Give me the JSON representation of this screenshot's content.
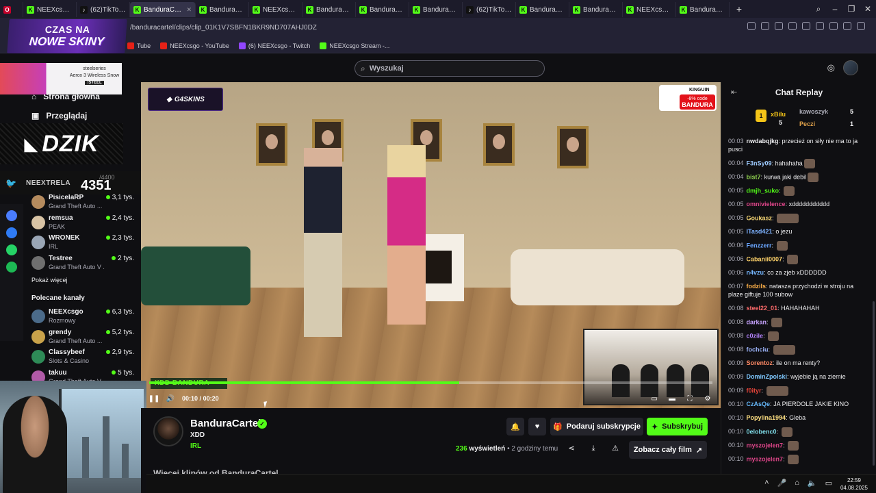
{
  "browser": {
    "tabs": [
      {
        "icon": "kick",
        "label": "NEEXcsgo Stream"
      },
      {
        "icon": "tiktok",
        "label": "(62)TikTok - Make"
      },
      {
        "icon": "kick",
        "label": "BanduraCartel - Watch",
        "active": true
      },
      {
        "icon": "kick",
        "label": "BanduraCartel - V"
      },
      {
        "icon": "kick",
        "label": "NEEXcsgo Stream"
      },
      {
        "icon": "kick",
        "label": "BanduraCartel - V"
      },
      {
        "icon": "kick",
        "label": "BanduraCartel - V"
      },
      {
        "icon": "kick",
        "label": "BanduraCartel - V"
      },
      {
        "icon": "tiktok",
        "label": "(62)TikTok - Make"
      },
      {
        "icon": "kick",
        "label": "BanduraCartel - V"
      },
      {
        "icon": "kick",
        "label": "BanduraCartel - V"
      },
      {
        "icon": "kick",
        "label": "NEEXcsgo Stream"
      },
      {
        "icon": "kick",
        "label": "BanduraCartel - V"
      }
    ],
    "new_tab_label": "+",
    "url": "/banduracartel/clips/clip_01K1V7SBFN1BKR9ND707AHJ0DZ",
    "bookmarks": [
      {
        "label": "Tube",
        "icon": "youtube"
      },
      {
        "label": "NEEXcsgo - YouTube",
        "icon": "youtube"
      },
      {
        "label": "(6) NEEXcsgo - Twitch",
        "icon": "twitch"
      },
      {
        "label": "NEEXcsgo Stream -...",
        "icon": "kick"
      }
    ]
  },
  "overlays": {
    "czas_line1": "CZAS NA",
    "czas_line2": "NOWE SKINY",
    "steelseries_brand": "steelseries",
    "steelseries_product": "Aerox 3 Wireless Snow",
    "steelseries_code": "!STEEL",
    "dzik_logo": "DZIK",
    "neex_handle": "NEEXTRELA",
    "goal": "/4400",
    "counter": "4351",
    "video_watermark": "G4SKINS",
    "kinguin_brand": "KINGUIN",
    "kinguin_discount": "-8% code",
    "kinguin_code": "BANDURA",
    "caption": "XDD BANDURA"
  },
  "sidebar": {
    "nav": [
      {
        "label": "Strona główna",
        "icon": "home-icon"
      },
      {
        "label": "Przeglądaj",
        "icon": "browse-icon"
      }
    ],
    "followed": [
      {
        "name": "PisicelaRP",
        "category": "Grand Theft Auto ...",
        "viewers": "3,1 tys.",
        "color": "#b58b5e"
      },
      {
        "name": "remsua",
        "category": "PEAK",
        "viewers": "2,4 tys.",
        "color": "#d8c3a5"
      },
      {
        "name": "WRONEK",
        "category": "IRL",
        "viewers": "2,3 tys.",
        "color": "#9aa6b6"
      },
      {
        "name": "Testree",
        "category": "Grand Theft Auto V ...",
        "viewers": "2 tys.",
        "color": "#6f6f6f"
      }
    ],
    "show_more": "Pokaż więcej",
    "recommended_heading": "Polecane kanały",
    "recommended": [
      {
        "name": "NEEXcsgo",
        "category": "Rozmowy",
        "viewers": "6,3 tys.",
        "color": "#4b6b8a"
      },
      {
        "name": "grendy",
        "category": "Grand Theft Auto ...",
        "viewers": "5,2 tys.",
        "color": "#c9a24a"
      },
      {
        "name": "Classybeef",
        "category": "Slots & Casino",
        "viewers": "2,9 tys.",
        "color": "#2e8b57"
      },
      {
        "name": "takuu",
        "category": "Grand Theft Auto V ...",
        "viewers": "5 tys.",
        "color": "#b05aa6"
      }
    ]
  },
  "header": {
    "search_placeholder": "Wyszukaj"
  },
  "player": {
    "time_current": "00:10",
    "time_separator": "/",
    "time_total": "00:20",
    "progress_fraction": 0.55
  },
  "clip": {
    "channel_name": "BanduraCartel",
    "title": "XDD",
    "category": "IRL",
    "gift_sub_label": "Podaruj subskrypcje",
    "subscribe_label": "Subskrybuj",
    "views_count": "236",
    "views_label": "wyświetleń",
    "posted": "• 2 godziny temu",
    "watch_full_label": "Zobacz cały film",
    "next_title": "Więcej klipów od BanduraCartel"
  },
  "chat": {
    "title": "Chat Replay",
    "gifters": [
      {
        "name": "xBilu",
        "count": "5",
        "rank": "1"
      },
      {
        "name": "kawoszyk",
        "count": "5"
      },
      {
        "name": "Peczi",
        "count": "1"
      }
    ],
    "messages": [
      {
        "time": "00:03",
        "user": "nwdabqjkg",
        "color": "#efeff1",
        "text": "przecież on siły nie ma to ja pusci"
      },
      {
        "time": "00:04",
        "user": "F3nSy09",
        "color": "#9ecbff",
        "text": "hahahaha",
        "emote": true
      },
      {
        "time": "00:04",
        "user": "bist7",
        "color": "#8fd14f",
        "text": "kurwa jaki debil",
        "emote": true
      },
      {
        "time": "00:05",
        "user": "dmjh_suko",
        "color": "#53fc18",
        "text": "",
        "emote": true
      },
      {
        "time": "00:05",
        "user": "omnivielence",
        "color": "#e0468a",
        "text": "xddddddddddd"
      },
      {
        "time": "00:05",
        "user": "Goukasz",
        "color": "#f7d774",
        "text": "",
        "emote": true,
        "wide": true
      },
      {
        "time": "00:05",
        "user": "ITasd421",
        "color": "#7db2ff",
        "text": "o jezu"
      },
      {
        "time": "00:06",
        "user": "Fenzzerr",
        "color": "#6aa6ff",
        "text": "",
        "emote": true
      },
      {
        "time": "00:06",
        "user": "Cabanii0007",
        "color": "#ffd36a",
        "text": "",
        "emote": true
      },
      {
        "time": "00:06",
        "user": "n4vzu",
        "color": "#76b7ff",
        "text": "co za zjeb xDDDDDD"
      },
      {
        "time": "00:07",
        "user": "fodzils",
        "color": "#ffb24a",
        "text": "natasza przychodzi w stroju na plaze giftuje 100 subow"
      },
      {
        "time": "00:08",
        "user": "steel22_01",
        "color": "#ff6b6b",
        "text": "HAHAHAHAH"
      },
      {
        "time": "00:08",
        "user": "darkan",
        "color": "#c7a4ff",
        "text": "",
        "emote": true
      },
      {
        "time": "00:08",
        "user": "c0zile",
        "color": "#b584ff",
        "text": "",
        "emote": true
      },
      {
        "time": "00:08",
        "user": "fochciu",
        "color": "#9fb7ff",
        "text": "",
        "emote": true,
        "wide": true
      },
      {
        "time": "00:09",
        "user": "Sorentoz",
        "color": "#ff8a65",
        "text": "ile on ma renty?"
      },
      {
        "time": "00:09",
        "user": "DominZpolski",
        "color": "#7fc8ff",
        "text": "wyjebie ją na ziemie"
      },
      {
        "time": "00:09",
        "user": "f0ityr",
        "color": "#e9453a",
        "text": "",
        "emote": true,
        "wide": true
      },
      {
        "time": "00:10",
        "user": "CzAsQe",
        "color": "#64b5f6",
        "text": "JA PIERDOLE JAKIE KINO"
      },
      {
        "time": "00:10",
        "user": "Popylina1994",
        "color": "#ffe082",
        "text": "Gleba"
      },
      {
        "time": "00:10",
        "user": "0elobenc0",
        "color": "#80deea",
        "text": "",
        "emote": true
      },
      {
        "time": "00:10",
        "user": "myszojelen7",
        "color": "#e0468a",
        "text": "",
        "emote": true
      },
      {
        "time": "00:10",
        "user": "myszojelen7",
        "color": "#e0468a",
        "text": "",
        "emote": true
      }
    ]
  },
  "taskbar": {
    "time": "22:59",
    "date": "04.08.2025"
  },
  "colors": {
    "accent": "#53fc18",
    "background": "#0f0f12"
  }
}
